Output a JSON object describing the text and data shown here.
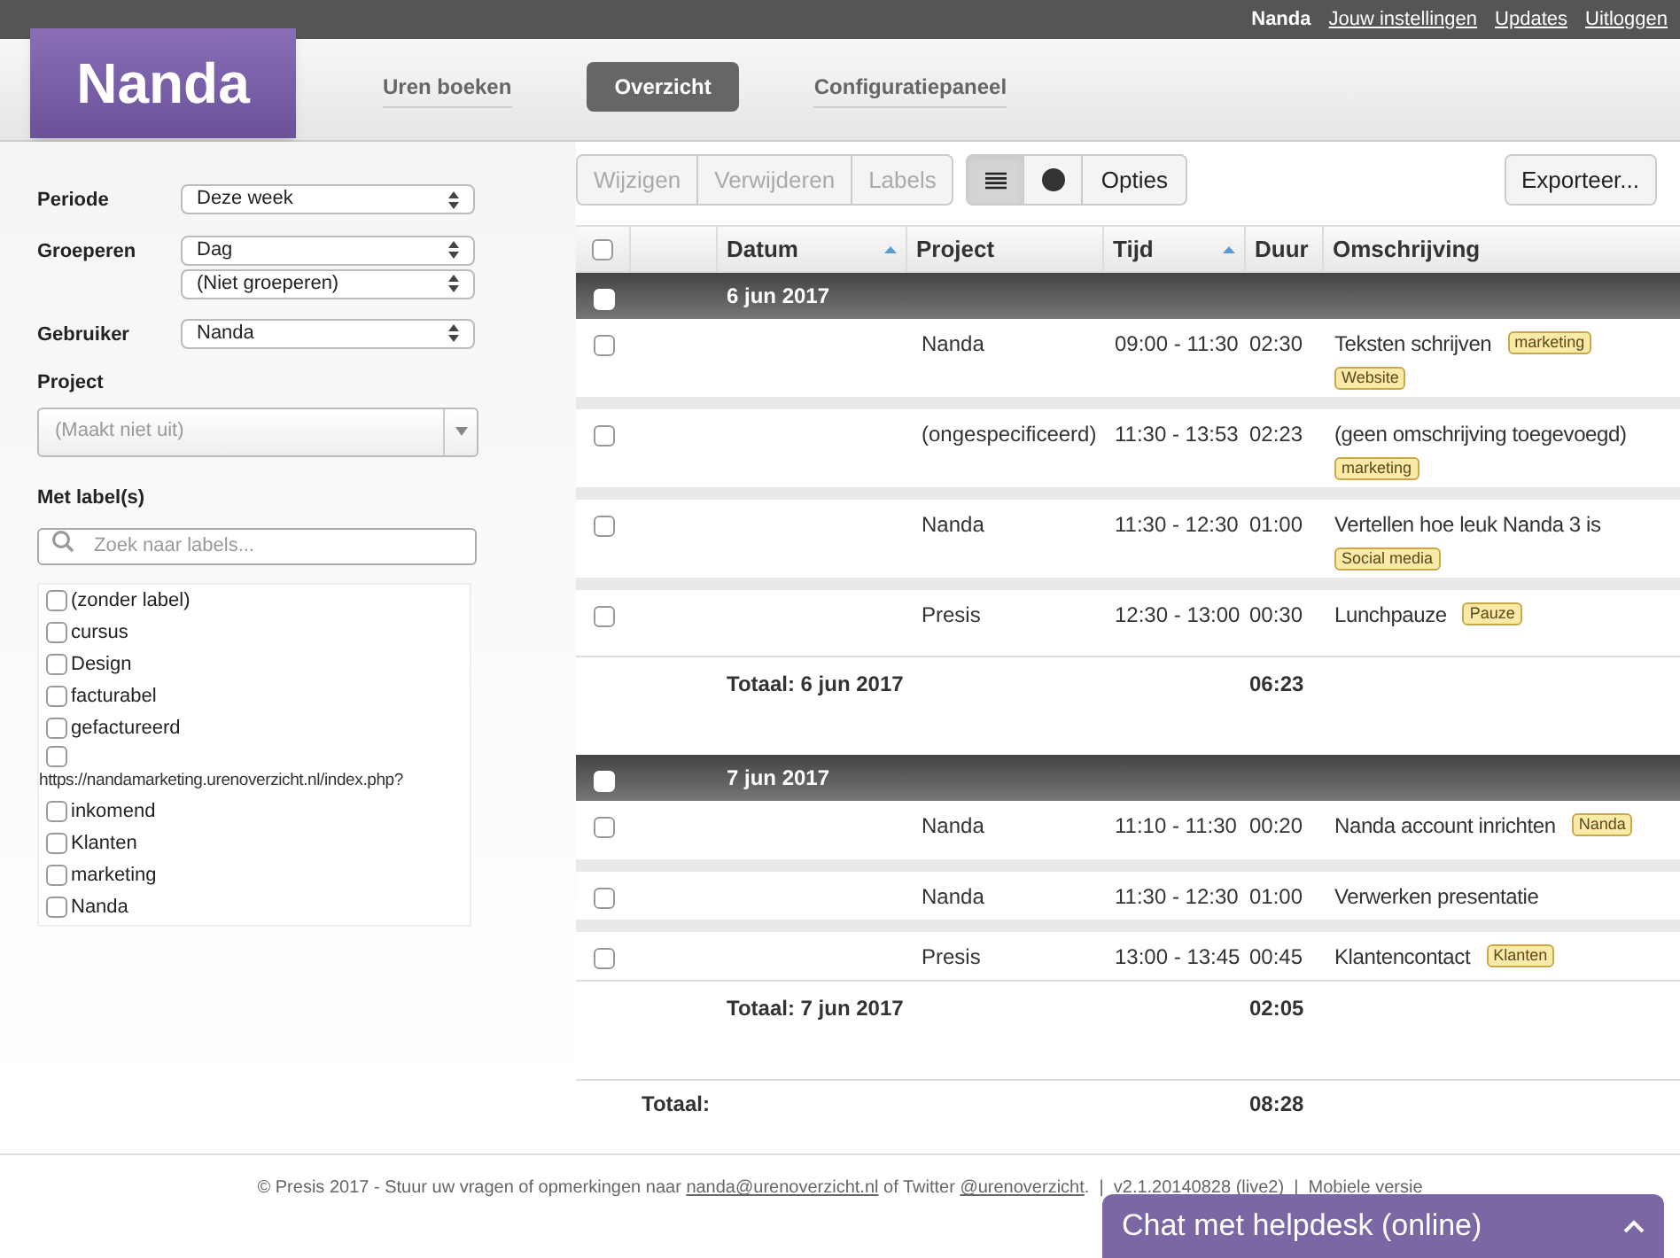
{
  "top_bar": {
    "user": "Nanda",
    "links": [
      "Jouw instellingen",
      "Updates",
      "Uitloggen"
    ]
  },
  "logo": "Nanda",
  "nav": [
    {
      "label": "Uren boeken",
      "selected": false
    },
    {
      "label": "Overzicht",
      "selected": true
    },
    {
      "label": "Configuratiepaneel",
      "selected": false
    }
  ],
  "filters": [
    {
      "label": "Periode",
      "selects": [
        "Deze week"
      ]
    },
    {
      "label": "Groeperen",
      "selects": [
        "Dag",
        "(Niet groeperen)"
      ]
    },
    {
      "label": "Gebruiker",
      "selects": [
        "Nanda"
      ]
    }
  ],
  "project": {
    "label": "Project",
    "placeholder": "(Maakt niet uit)"
  },
  "labels_filter": {
    "label": "Met label(s)",
    "placeholder": "Zoek naar labels...",
    "items": [
      {
        "name": "(zonder label)",
        "checked": false
      },
      {
        "name": "cursus",
        "checked": false
      },
      {
        "name": "Design",
        "checked": false
      },
      {
        "name": "facturabel",
        "checked": false
      },
      {
        "name": "gefactureerd",
        "checked": false
      },
      {
        "name": "https://nandamarketing.urenoverzicht.nl/index.php?",
        "checked": false
      },
      {
        "name": "inkomend",
        "checked": false
      },
      {
        "name": "Klanten",
        "checked": false
      },
      {
        "name": "marketing",
        "checked": false
      },
      {
        "name": "Nanda",
        "checked": false
      }
    ]
  },
  "toolbar": {
    "actions": [
      {
        "label": "Wijzigen",
        "disabled": true
      },
      {
        "label": "Verwijderen",
        "disabled": true
      },
      {
        "label": "Labels",
        "disabled": true
      }
    ],
    "views": [
      {
        "kind": "list",
        "selected": true
      },
      {
        "kind": "pie",
        "selected": false
      }
    ],
    "options": "Opties",
    "export": "Exporteer..."
  },
  "table": {
    "all_checked": false,
    "columns": [
      {
        "label": "Datum",
        "sorted": true
      },
      {
        "label": "Project",
        "sorted": false
      },
      {
        "label": "Tijd",
        "sorted": true
      },
      {
        "label": "Duur",
        "sorted": false
      },
      {
        "label": "Omschrijving",
        "sorted": false
      }
    ],
    "groups": [
      {
        "date": "6 jun 2017",
        "checked": false,
        "total_label": "Totaal: 6 jun 2017",
        "total": "06:23",
        "entries": [
          {
            "project": "Nanda",
            "time": "09:00 - 11:30",
            "duration": "02:30",
            "description": "Teksten schrijven",
            "labels": [
              "marketing",
              "Website"
            ],
            "checked": false
          },
          {
            "project": "(ongespecificeerd)",
            "time": "11:30 - 13:53",
            "duration": "02:23",
            "description": "(geen omschrijving toegevoegd)",
            "labels": [
              "marketing"
            ],
            "checked": false
          },
          {
            "project": "Nanda",
            "time": "11:30 - 12:30",
            "duration": "01:00",
            "description": "Vertellen hoe leuk Nanda 3 is",
            "labels": [
              "Social media"
            ],
            "checked": false
          },
          {
            "project": "Presis",
            "time": "12:30 - 13:00",
            "duration": "00:30",
            "description": "Lunchpauze",
            "labels": [
              "Pauze"
            ],
            "checked": false
          }
        ]
      },
      {
        "date": "7 jun 2017",
        "checked": false,
        "total_label": "Totaal: 7 jun 2017",
        "total": "02:05",
        "entries": [
          {
            "project": "Nanda",
            "time": "11:10 - 11:30",
            "duration": "00:20",
            "description": "Nanda account inrichten",
            "labels": [
              "Nanda"
            ],
            "checked": false
          },
          {
            "project": "Nanda",
            "time": "11:30 - 12:30",
            "duration": "01:00",
            "description": "Verwerken presentatie",
            "checked": false
          },
          {
            "project": "Presis",
            "time": "13:00 - 13:45",
            "duration": "00:45",
            "description": "Klantencontact",
            "labels": [
              "Klanten"
            ],
            "checked": false
          }
        ]
      }
    ],
    "grand_total_label": "Totaal:",
    "grand_total": "08:28"
  },
  "footer": {
    "text1": "© Presis 2017 - Stuur uw vragen of opmerkingen naar ",
    "email": "nanda@urenoverzicht.nl",
    "text2": " of Twitter ",
    "twitter": "@urenoverzicht",
    "text3": ".  |  v2.1.20140828 (live2)  |  ",
    "mobile": "Mobiele versie"
  },
  "chat": {
    "label": "Chat met helpdesk (online)",
    "expanded": false
  }
}
